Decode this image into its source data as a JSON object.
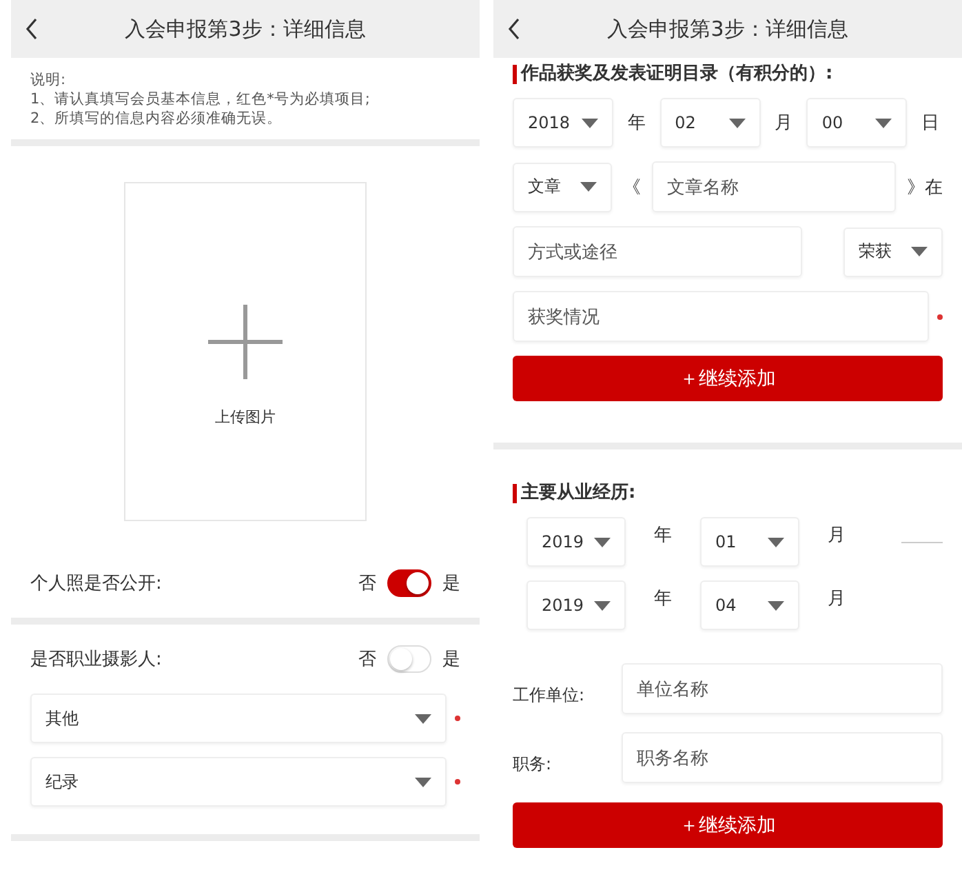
{
  "left_screen": {
    "title": "入会申报第3步：详细信息",
    "notes": [
      "说明:",
      "1、请认真填写会员基本信息，红色*号为必填项目;",
      "2、所填写的信息内容必须准确无误。"
    ],
    "upload": {
      "label": "上传图片"
    },
    "toggles": [
      {
        "label": "个人照是否公开:",
        "off_label": "否",
        "on_label": "是",
        "on": true
      },
      {
        "label": "是否职业摄影人:",
        "off_label": "否",
        "on_label": "是",
        "on": false
      }
    ],
    "selects": [
      {
        "value": "其他",
        "required": true
      },
      {
        "value": "纪录",
        "required": true
      }
    ]
  },
  "right_screen": {
    "title": "入会申报第3步：详细信息",
    "awards": {
      "heading": "作品获奖及发表证明目录（有积分的）:",
      "date": [
        {
          "value": "2018",
          "unit": "年"
        },
        {
          "value": "02",
          "unit": "月"
        },
        {
          "value": "00",
          "unit": "日"
        }
      ],
      "type_select": "文章",
      "open_quote": "《",
      "name_field": {
        "placeholder": "文章名称"
      },
      "close_text": "》在",
      "channel_field": {
        "placeholder": "方式或途径"
      },
      "result_select": "荣获",
      "result_field": {
        "placeholder": "获奖情况",
        "required": true
      },
      "add_button": "＋继续添加"
    },
    "career": {
      "heading": "主要从业经历:",
      "periods": [
        [
          {
            "value": "2019",
            "unit": "年"
          },
          {
            "value": "01",
            "unit": "月"
          }
        ],
        [
          {
            "value": "2019",
            "unit": "年"
          },
          {
            "value": "04",
            "unit": "月"
          }
        ]
      ],
      "fields": [
        {
          "label": "工作单位:",
          "placeholder": "单位名称"
        },
        {
          "label": "职务:",
          "placeholder": "职务名称"
        }
      ],
      "add_button": "＋继续添加"
    }
  }
}
